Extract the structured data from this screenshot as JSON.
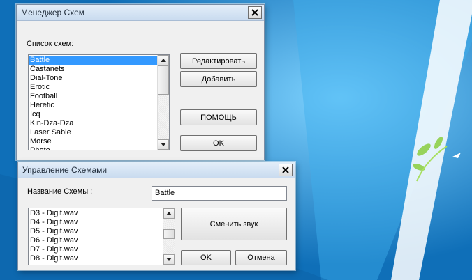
{
  "scheme_manager": {
    "title": "Менеджер Схем",
    "list_label": "Список схем:",
    "schemes": [
      "Battle",
      "Castanets",
      "Dial-Tone",
      "Erotic",
      "Football",
      "Heretic",
      "Icq",
      "Kin-Dza-Dza",
      "Laser Sable",
      "Morse",
      "Photo"
    ],
    "selected_index": 0,
    "buttons": {
      "edit": "Редактировать",
      "add": "Добавить",
      "help": "ПОМОЩЬ",
      "ok": "OK"
    }
  },
  "scheme_editor": {
    "title": "Управление Схемами",
    "name_label": "Название Схемы :",
    "name_value": "Battle",
    "sounds": [
      "D3 - Digit.wav",
      "D4 - Digit.wav",
      "D5 - Digit.wav",
      "D6 - Digit.wav",
      "D7 - Digit.wav",
      "D8 - Digit.wav"
    ],
    "buttons": {
      "change_sound": "Сменить звук",
      "ok": "OK",
      "cancel": "Отмена"
    }
  },
  "colors": {
    "desktop": "#1a8fd6",
    "selection": "#3399ff",
    "window_bg": "#f0f0f0"
  },
  "icons": {
    "close": "close-icon",
    "scroll_up": "arrow-up-icon",
    "scroll_down": "arrow-down-icon"
  }
}
